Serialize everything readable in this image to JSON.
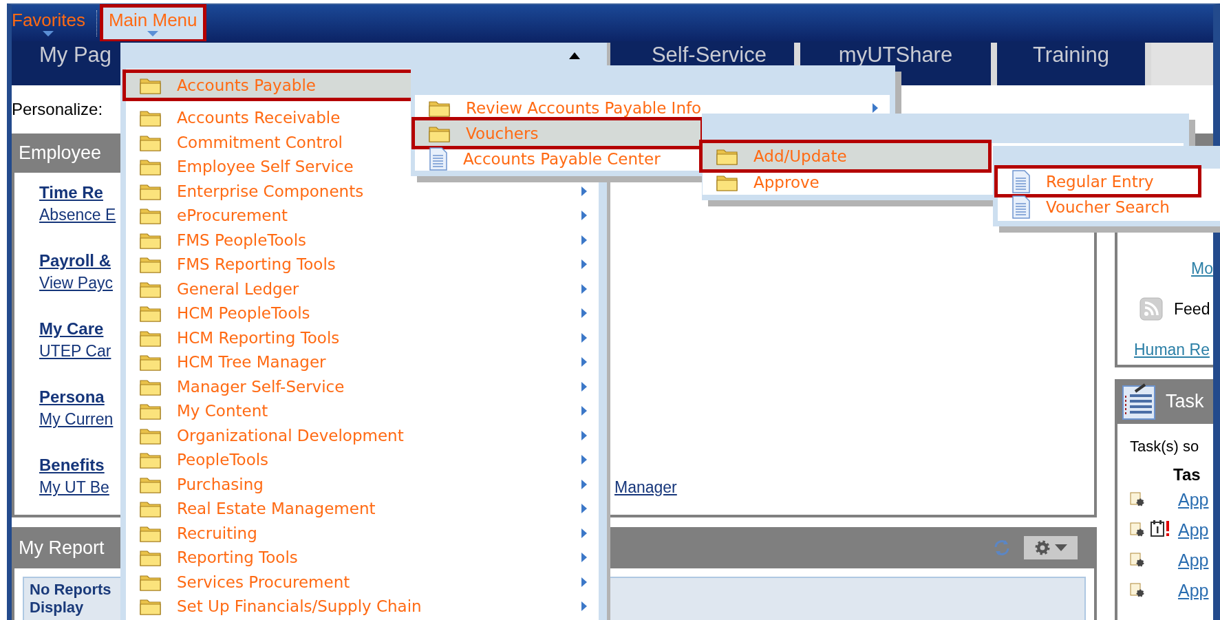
{
  "nav": {
    "items": [
      {
        "label": "Favorites",
        "selected": false,
        "callout": false
      },
      {
        "label": "Main Menu",
        "selected": true,
        "callout": true
      }
    ]
  },
  "tabs": [
    {
      "label": "My Pag"
    },
    {
      "label": "Self-Service"
    },
    {
      "label": "myUTShare"
    },
    {
      "label": "Training"
    }
  ],
  "personalize": {
    "label": "Personalize:"
  },
  "employee_pagelet": {
    "title": "Employee",
    "groups": [
      {
        "title": "Time Re",
        "link": "Absence E"
      },
      {
        "title": "Payroll &",
        "link": "View Payc"
      },
      {
        "title": "My Care",
        "link": "UTEP Car"
      },
      {
        "title": "Persona",
        "link": "My Curren"
      },
      {
        "title": "Benefits",
        "link": "My UT Be",
        "extra_link": "Manager"
      }
    ]
  },
  "reports_pagelet": {
    "title": "My Report",
    "message": [
      "No Reports",
      "Display"
    ]
  },
  "links_pagelet": {
    "items": [
      {
        "kind": "link",
        "label": "Mo"
      },
      {
        "kind": "feed",
        "label": "Feed"
      },
      {
        "kind": "link",
        "label": "Human Re"
      }
    ]
  },
  "tasks_pagelet": {
    "title": "Task",
    "summary": "Task(s) so",
    "column_header": "Tas",
    "rows": [
      {
        "label": "App",
        "flagged": false
      },
      {
        "label": "App",
        "flagged": true
      },
      {
        "label": "App",
        "flagged": false
      },
      {
        "label": "App",
        "flagged": false
      }
    ]
  },
  "menus": [
    {
      "items": [
        {
          "label": "Accounts Payable",
          "kind": "folder",
          "selected": true,
          "callout": true,
          "arrow": false
        },
        {
          "label": "Accounts Receivable",
          "kind": "folder",
          "selected": false,
          "callout": false,
          "arrow": false
        },
        {
          "label": "Commitment Control",
          "kind": "folder",
          "selected": false,
          "callout": false,
          "arrow": false
        },
        {
          "label": "Employee Self Service",
          "kind": "folder",
          "selected": false,
          "callout": false,
          "arrow": false
        },
        {
          "label": "Enterprise Components",
          "kind": "folder",
          "selected": false,
          "callout": false,
          "arrow": true
        },
        {
          "label": "eProcurement",
          "kind": "folder",
          "selected": false,
          "callout": false,
          "arrow": true
        },
        {
          "label": "FMS PeopleTools",
          "kind": "folder",
          "selected": false,
          "callout": false,
          "arrow": true
        },
        {
          "label": "FMS Reporting Tools",
          "kind": "folder",
          "selected": false,
          "callout": false,
          "arrow": true
        },
        {
          "label": "General Ledger",
          "kind": "folder",
          "selected": false,
          "callout": false,
          "arrow": true
        },
        {
          "label": "HCM PeopleTools",
          "kind": "folder",
          "selected": false,
          "callout": false,
          "arrow": true
        },
        {
          "label": "HCM Reporting Tools",
          "kind": "folder",
          "selected": false,
          "callout": false,
          "arrow": true
        },
        {
          "label": "HCM Tree Manager",
          "kind": "folder",
          "selected": false,
          "callout": false,
          "arrow": true
        },
        {
          "label": "Manager Self-Service",
          "kind": "folder",
          "selected": false,
          "callout": false,
          "arrow": true
        },
        {
          "label": "My Content",
          "kind": "folder",
          "selected": false,
          "callout": false,
          "arrow": true
        },
        {
          "label": "Organizational Development",
          "kind": "folder",
          "selected": false,
          "callout": false,
          "arrow": true
        },
        {
          "label": "PeopleTools",
          "kind": "folder",
          "selected": false,
          "callout": false,
          "arrow": true
        },
        {
          "label": "Purchasing",
          "kind": "folder",
          "selected": false,
          "callout": false,
          "arrow": true
        },
        {
          "label": "Real Estate Management",
          "kind": "folder",
          "selected": false,
          "callout": false,
          "arrow": true
        },
        {
          "label": "Recruiting",
          "kind": "folder",
          "selected": false,
          "callout": false,
          "arrow": true
        },
        {
          "label": "Reporting Tools",
          "kind": "folder",
          "selected": false,
          "callout": false,
          "arrow": true
        },
        {
          "label": "Services Procurement",
          "kind": "folder",
          "selected": false,
          "callout": false,
          "arrow": true
        },
        {
          "label": "Set Up Financials/Supply Chain",
          "kind": "folder",
          "selected": false,
          "callout": false,
          "arrow": true
        }
      ]
    },
    {
      "items": [
        {
          "label": "Review Accounts Payable Info",
          "kind": "folder",
          "selected": false,
          "callout": false,
          "arrow": true
        },
        {
          "label": "Vouchers",
          "kind": "folder",
          "selected": true,
          "callout": true,
          "arrow": false
        },
        {
          "label": "Accounts Payable Center",
          "kind": "page",
          "selected": false,
          "callout": false,
          "arrow": false
        }
      ]
    },
    {
      "items": [
        {
          "label": "Add/Update",
          "kind": "folder",
          "selected": true,
          "callout": true,
          "arrow": false
        },
        {
          "label": "Approve",
          "kind": "folder",
          "selected": false,
          "callout": false,
          "arrow": false
        }
      ]
    },
    {
      "items": [
        {
          "label": "Regular Entry",
          "kind": "page",
          "selected": false,
          "callout": true,
          "arrow": false
        },
        {
          "label": "Voucher Search",
          "kind": "page",
          "selected": false,
          "callout": false,
          "arrow": false
        }
      ]
    }
  ]
}
